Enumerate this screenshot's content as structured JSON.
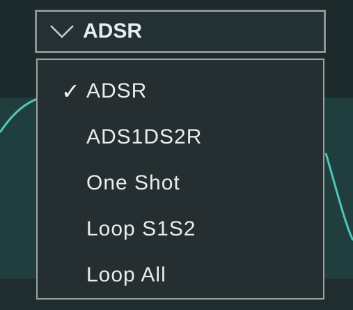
{
  "colors": {
    "panel_bg": "#1c2a2c",
    "menu_bg": "#252f31",
    "menu_border": "#9aa1a2",
    "text": "#e9eded",
    "accent_curve": "#4fc7b8"
  },
  "select": {
    "icon": "chevron-down-icon",
    "value": "ADSR"
  },
  "menu": {
    "check_icon": "checkmark-icon",
    "check_glyph": "✓",
    "items": [
      {
        "label": "ADSR",
        "selected": true
      },
      {
        "label": "ADS1DS2R",
        "selected": false
      },
      {
        "label": "One Shot",
        "selected": false
      },
      {
        "label": "Loop S1S2",
        "selected": false
      },
      {
        "label": "Loop All",
        "selected": false
      }
    ]
  }
}
